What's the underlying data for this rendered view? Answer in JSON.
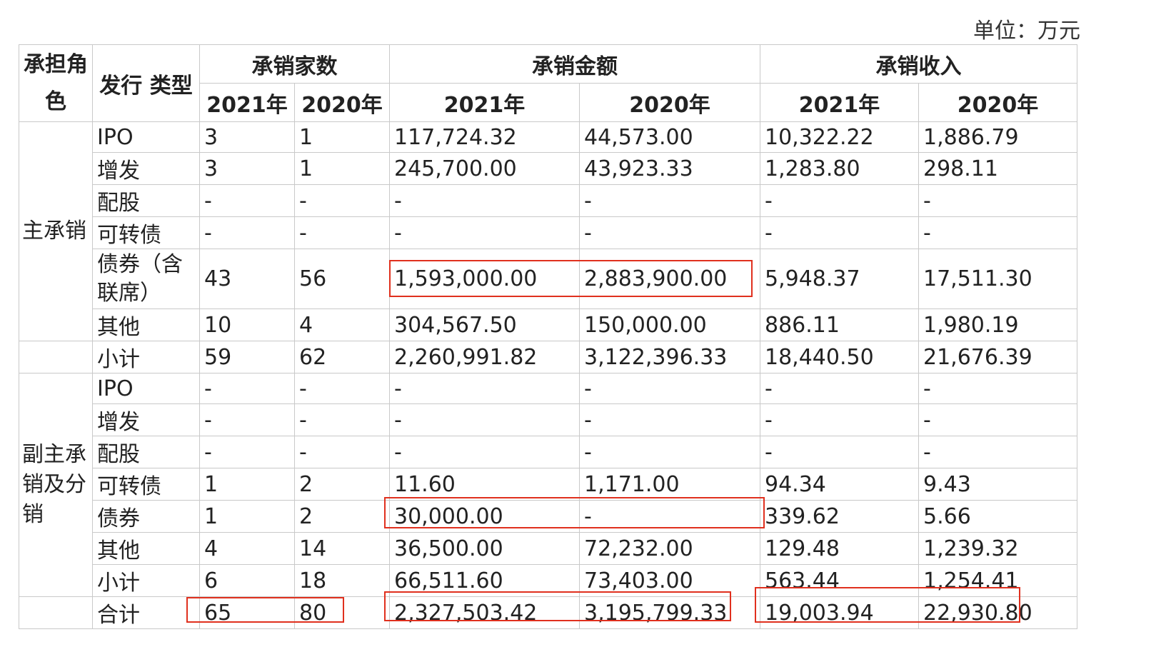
{
  "unit_label": "单位：万元",
  "headers": {
    "role": "承担角色",
    "type": "发行 类型",
    "count": "承销家数",
    "amount": "承销金额",
    "income": "承销收入",
    "y2021": "2021年",
    "y2020": "2020年"
  },
  "groups": [
    {
      "role": "主承销",
      "rows": [
        {
          "type": "IPO",
          "c21": "3",
          "c20": "1",
          "a21": "117,724.32",
          "a20": "44,573.00",
          "i21": "10,322.22",
          "i20": "1,886.79"
        },
        {
          "type": "增发",
          "c21": "3",
          "c20": "1",
          "a21": "245,700.00",
          "a20": "43,923.33",
          "i21": "1,283.80",
          "i20": "298.11"
        },
        {
          "type": "配股",
          "c21": "-",
          "c20": "-",
          "a21": "-",
          "a20": "-",
          "i21": "-",
          "i20": "-"
        },
        {
          "type": "可转债",
          "c21": "-",
          "c20": "-",
          "a21": "-",
          "a20": "-",
          "i21": "-",
          "i20": "-"
        },
        {
          "type": "债券（含联席）",
          "c21": "43",
          "c20": "56",
          "a21": "1,593,000.00",
          "a20": "2,883,900.00",
          "i21": "5,948.37",
          "i20": "17,511.30"
        },
        {
          "type": "其他",
          "c21": "10",
          "c20": "4",
          "a21": "304,567.50",
          "a20": "150,000.00",
          "i21": "886.11",
          "i20": "1,980.19"
        }
      ],
      "subtotal": {
        "type": "小计",
        "c21": "59",
        "c20": "62",
        "a21": "2,260,991.82",
        "a20": "3,122,396.33",
        "i21": "18,440.50",
        "i20": "21,676.39"
      }
    },
    {
      "role": "副主承销及分销",
      "rows": [
        {
          "type": "IPO",
          "c21": "-",
          "c20": "-",
          "a21": "-",
          "a20": "-",
          "i21": "-",
          "i20": "-"
        },
        {
          "type": "增发",
          "c21": "-",
          "c20": "-",
          "a21": "-",
          "a20": "-",
          "i21": "-",
          "i20": "-"
        },
        {
          "type": "配股",
          "c21": "-",
          "c20": "-",
          "a21": "-",
          "a20": "-",
          "i21": "-",
          "i20": "-"
        },
        {
          "type": "可转债",
          "c21": "1",
          "c20": "2",
          "a21": "11.60",
          "a20": "1,171.00",
          "i21": "94.34",
          "i20": "9.43"
        },
        {
          "type": "债券",
          "c21": "1",
          "c20": "2",
          "a21": "30,000.00",
          "a20": "-",
          "i21": "339.62",
          "i20": "5.66"
        },
        {
          "type": "其他",
          "c21": "4",
          "c20": "14",
          "a21": "36,500.00",
          "a20": "72,232.00",
          "i21": "129.48",
          "i20": "1,239.32"
        },
        {
          "type": "小计",
          "c21": "6",
          "c20": "18",
          "a21": "66,511.60",
          "a20": "73,403.00",
          "i21": "563.44",
          "i20": "1,254.41"
        }
      ]
    }
  ],
  "total": {
    "type": "合计",
    "c21": "65",
    "c20": "80",
    "a21": "2,327,503.42",
    "a20": "3,195,799.33",
    "i21": "19,003.94",
    "i20": "22,930.80"
  },
  "highlight_color": "#e0301e"
}
